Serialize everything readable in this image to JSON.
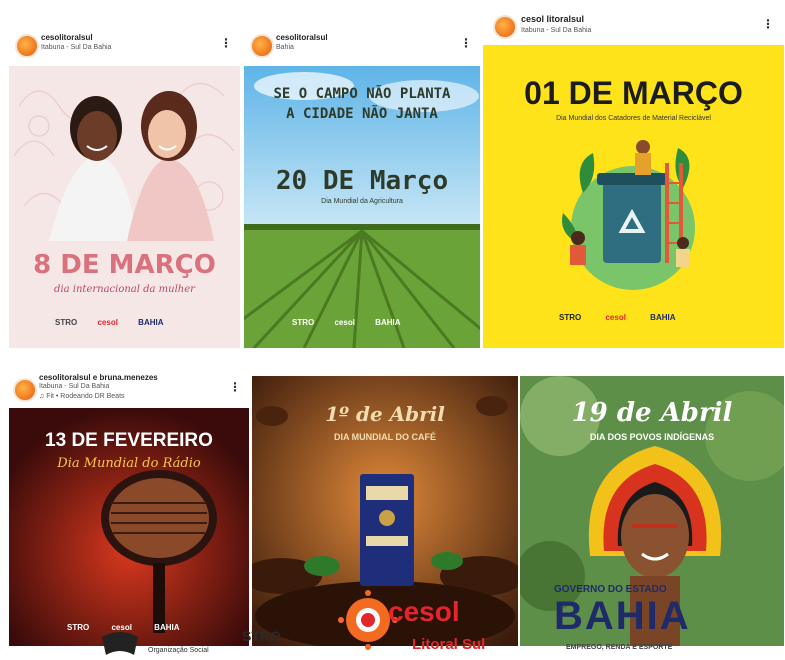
{
  "posts": [
    {
      "username": "cesolitoralsul",
      "location": "Itabuna - Sul Da Bahia",
      "headline": "8 DE MARÇO",
      "subtitle": "dia internacional da mulher"
    },
    {
      "username": "cesolitoralsul",
      "location": "Bahia",
      "headline_line1": "SE O CAMPO NÃO PLANTA",
      "headline_line2": "A CIDADE NÃO JANTA",
      "date": "20 DE Março",
      "subtitle": "Dia Mundial da Agricultura"
    },
    {
      "username": "cesol litoralsul",
      "location": "Itabuna - Sul Da Bahia",
      "headline": "01 DE MARÇO",
      "subtitle": "Dia Mundial dos Catadores de Material Reciclável"
    },
    {
      "username": "cesolitoralsul e bruna.menezes",
      "location": "Itabuna - Sul Da Bahia",
      "music_line": "♫ Fit • Rodeando DR Beats",
      "headline": "13 DE FEVEREIRO",
      "subtitle": "Dia Mundial do Rádio"
    },
    {
      "headline_line1": "1º de Abril",
      "headline_line2": "DIA MUNDIAL DO CAFÉ"
    },
    {
      "headline": "19 de Abril",
      "subtitle": "DIA DOS POVOS INDÍGENAS"
    }
  ],
  "footer_logos": {
    "partner_left": "STRO",
    "partner_left_sub": "Organização Social",
    "cesol_brand": "cesol",
    "cesol_sub": "Litoral Sul",
    "gov_prefix": "GOVERNO DO ESTADO",
    "bahia": "BAHIA",
    "bahia_sub": "EMPREGO, RENDA E ESPORTE"
  },
  "colors": {
    "pink_bg": "#f6e7e7",
    "pink_text": "#d9727d",
    "yellow_bg": "#ffe31a",
    "radio_red": "#7a1110",
    "coffee_brown": "#6b3a1c",
    "cesol_orange": "#f36b21",
    "cesol_red": "#e3262b",
    "bahia_navy": "#1f2a6b"
  },
  "icons": [
    "more-options-icon",
    "avatar-icon",
    "recycle-icon",
    "microphone-icon",
    "coffee-bag-icon",
    "sun-icon"
  ]
}
